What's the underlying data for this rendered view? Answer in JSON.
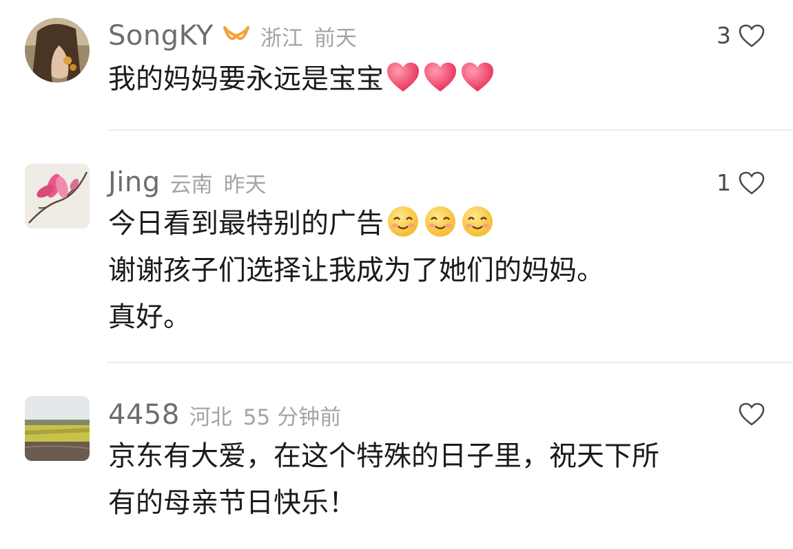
{
  "comments": [
    {
      "username": "SongKY",
      "region": "浙江",
      "time": "前天",
      "likes": "3",
      "lines": [
        "我的妈妈要永远是宝宝"
      ],
      "emoji": "red-heart-icon"
    },
    {
      "username": "Jing",
      "region": "云南",
      "time": "昨天",
      "likes": "1",
      "lines": [
        "今日看到最特别的广告",
        "谢谢孩子们选择让我成为了她们的妈妈。",
        "真好。"
      ],
      "emoji": "smiling-face-icon"
    },
    {
      "username": "4458",
      "region": "河北",
      "time": "55 分钟前",
      "likes": "",
      "lines": [
        "京东有大爱，在这个特殊的日子里，祝天下所",
        "有的母亲节日快乐！"
      ]
    }
  ],
  "colors": {
    "username": "#6d6d6d",
    "meta": "#a4a4a4",
    "body": "#1b1b1b",
    "badge": "#f2a43a",
    "emoji_heart": "#f04a6e"
  }
}
